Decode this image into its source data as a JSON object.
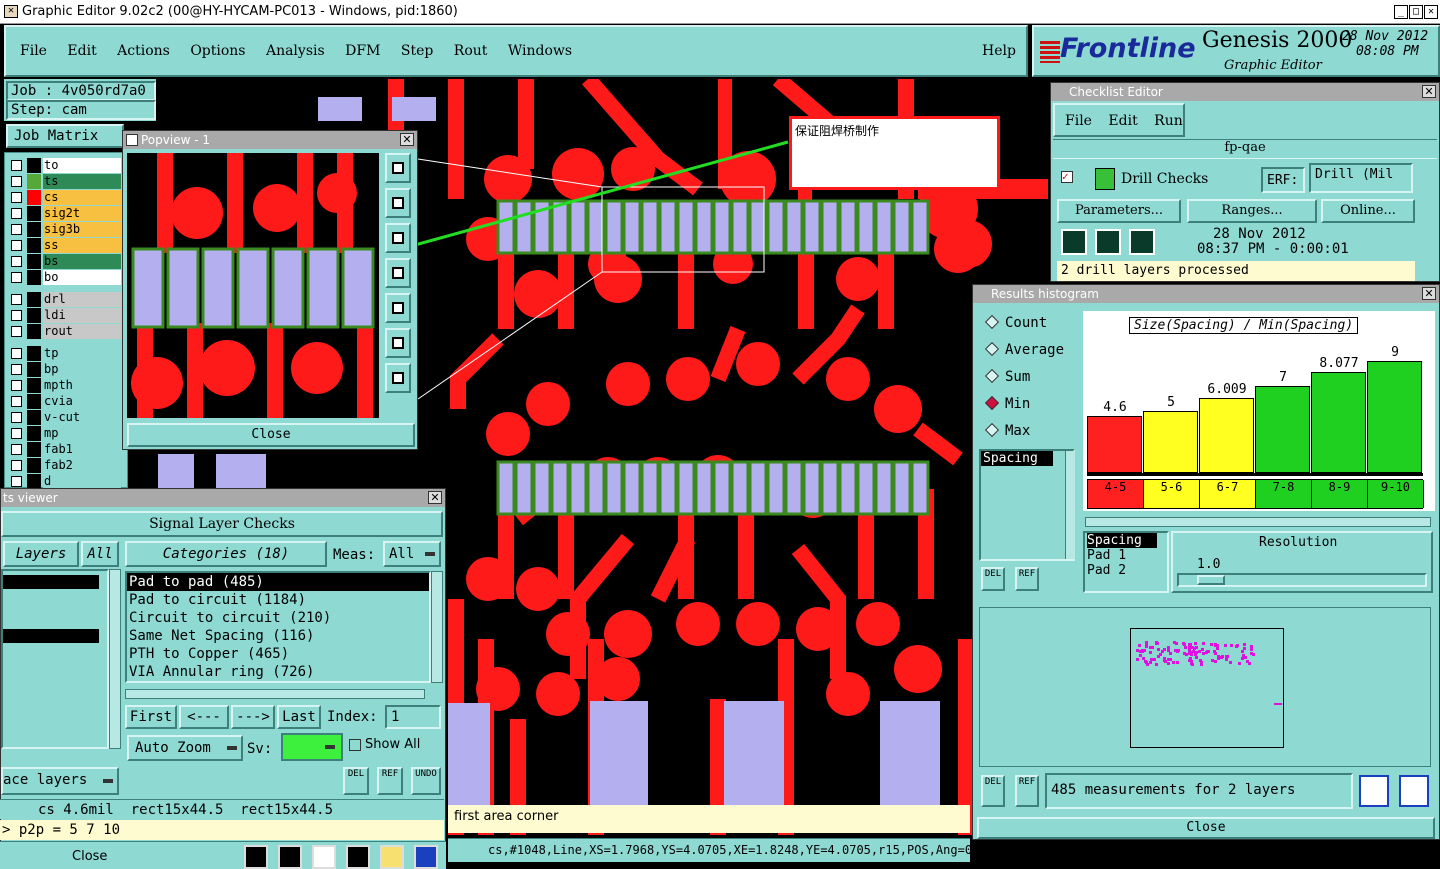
{
  "window": {
    "title": "Graphic Editor 9.02c2 (00@HY-HYCAM-PC013 - Windows, pid:1860)",
    "min": "_",
    "max": "□",
    "close": "✕"
  },
  "menu": {
    "items": [
      "File",
      "Edit",
      "Actions",
      "Options",
      "Analysis",
      "DFM",
      "Step",
      "Rout",
      "Windows"
    ],
    "help": "Help"
  },
  "brand": {
    "logo": "Frontline",
    "product": "Genesis 2000",
    "subtitle": "Graphic Editor",
    "date": "28 Nov 2012",
    "time": "08:08 PM"
  },
  "job": {
    "job_label": "Job : 4v050rd7a0",
    "step_label": "Step: cam",
    "matrix_btn": "Job Matrix"
  },
  "layers": [
    {
      "name": "to",
      "color": "#ffffff",
      "swatch": "#000000"
    },
    {
      "name": "ts",
      "color": "#2e8b57",
      "swatch": "#57a83a"
    },
    {
      "name": "cs",
      "color": "#f8c040",
      "swatch": "#ff0000"
    },
    {
      "name": "sig2t",
      "color": "#f8c040",
      "swatch": "#000000"
    },
    {
      "name": "sig3b",
      "color": "#f8c040",
      "swatch": "#000000"
    },
    {
      "name": "ss",
      "color": "#f8c040",
      "swatch": "#000000"
    },
    {
      "name": "bs",
      "color": "#2e8b57",
      "swatch": "#000000"
    },
    {
      "name": "bo",
      "color": "#ffffff",
      "swatch": "#000000"
    },
    {
      "name": "drl",
      "color": "#c8c8c8",
      "swatch": "#000000"
    },
    {
      "name": "ldi",
      "color": "#c8c8c8",
      "swatch": "#000000"
    },
    {
      "name": "rout",
      "color": "#c8c8c8",
      "swatch": "#000000"
    },
    {
      "name": "tp",
      "color": "#8fd9d3",
      "swatch": "#000000"
    },
    {
      "name": "bp",
      "color": "#8fd9d3",
      "swatch": "#000000"
    },
    {
      "name": "mpth",
      "color": "#8fd9d3",
      "swatch": "#000000"
    },
    {
      "name": "cvia",
      "color": "#8fd9d3",
      "swatch": "#000000"
    },
    {
      "name": "v-cut",
      "color": "#8fd9d3",
      "swatch": "#000000"
    },
    {
      "name": "mp",
      "color": "#8fd9d3",
      "swatch": "#000000"
    },
    {
      "name": "fab1",
      "color": "#8fd9d3",
      "swatch": "#000000"
    },
    {
      "name": "fab2",
      "color": "#8fd9d3",
      "swatch": "#000000"
    },
    {
      "name": "d",
      "color": "#8fd9d3",
      "swatch": "#000000"
    }
  ],
  "popview": {
    "title": "Popview - 1",
    "close": "Close"
  },
  "annotation": {
    "text": "保证阻焊桥制作"
  },
  "checklist": {
    "title": "Checklist Editor",
    "menu": [
      "File",
      "Edit",
      "Run"
    ],
    "name": "fp-qae",
    "check": "Drill Checks",
    "erf": "ERF:",
    "erf_value": "Drill (Mil",
    "params": "Parameters...",
    "ranges": "Ranges...",
    "online": "Online...",
    "date": "28 Nov 2012",
    "time": "08:37 PM - 0:00:01",
    "status": "2 drill layers processed"
  },
  "histogram": {
    "title": "Results histogram",
    "modes": [
      "Count",
      "Average",
      "Sum",
      "Min",
      "Max"
    ],
    "selected_mode": "Min",
    "list_item": "Spacing",
    "chart_title": "Size(Spacing) / Min(Spacing)",
    "res_items": [
      "Spacing",
      "Pad 1",
      "Pad 2"
    ],
    "resolution": "Resolution",
    "res_value": "1.0",
    "del": "DEL",
    "ref": "REF",
    "summary": "485 measurements for 2 layers",
    "close": "Close"
  },
  "chart_data": {
    "type": "bar",
    "title": "Size(Spacing) / Min(Spacing)",
    "categories": [
      "4-5",
      "5-6",
      "6-7",
      "7-8",
      "8-9",
      "9-10"
    ],
    "values": [
      4.6,
      5,
      6.009,
      7,
      8.077,
      9
    ],
    "value_labels": [
      "4.6",
      "5",
      "6.009",
      "7",
      "8.077",
      "9"
    ],
    "colors": [
      "#ff2020",
      "#ffff20",
      "#ffff20",
      "#20d020",
      "#20d020",
      "#20d020"
    ],
    "ylim": [
      0,
      10
    ]
  },
  "results_viewer": {
    "title": "ts viewer",
    "heading": "Signal Layer Checks",
    "layers_tab": "Layers",
    "all_tab": "All",
    "categories": "Categories (18)",
    "meas_label": "Meas:",
    "meas_value": "All",
    "items": [
      "Pad to pad (485)",
      "Pad to circuit (1184)",
      "Circuit to circuit (210)",
      "Same Net Spacing (116)",
      "PTH to Copper (465)",
      "VIA Annular ring (726)"
    ],
    "first": "First",
    "prev": "<---",
    "next": "--->",
    "last": "Last",
    "index_label": "Index:",
    "index_value": "1",
    "auto_zoom": "Auto Zoom",
    "sv": "Sv:",
    "show_all": "Show All",
    "surface": "ace layers",
    "del": "DEL",
    "ref": "REF",
    "undo": "UNDO"
  },
  "status": {
    "measure": "cs 4.6mil  rect15x44.5  rect15x44.5",
    "command": "> p2p = 5 7 10",
    "close": "Close",
    "prompt": "first area corner",
    "coords": "cs,#1048,Line,XS=1.7968,YS=4.0705,XE=1.8248,YE=4.0705,r15,POS,Ang=0"
  }
}
